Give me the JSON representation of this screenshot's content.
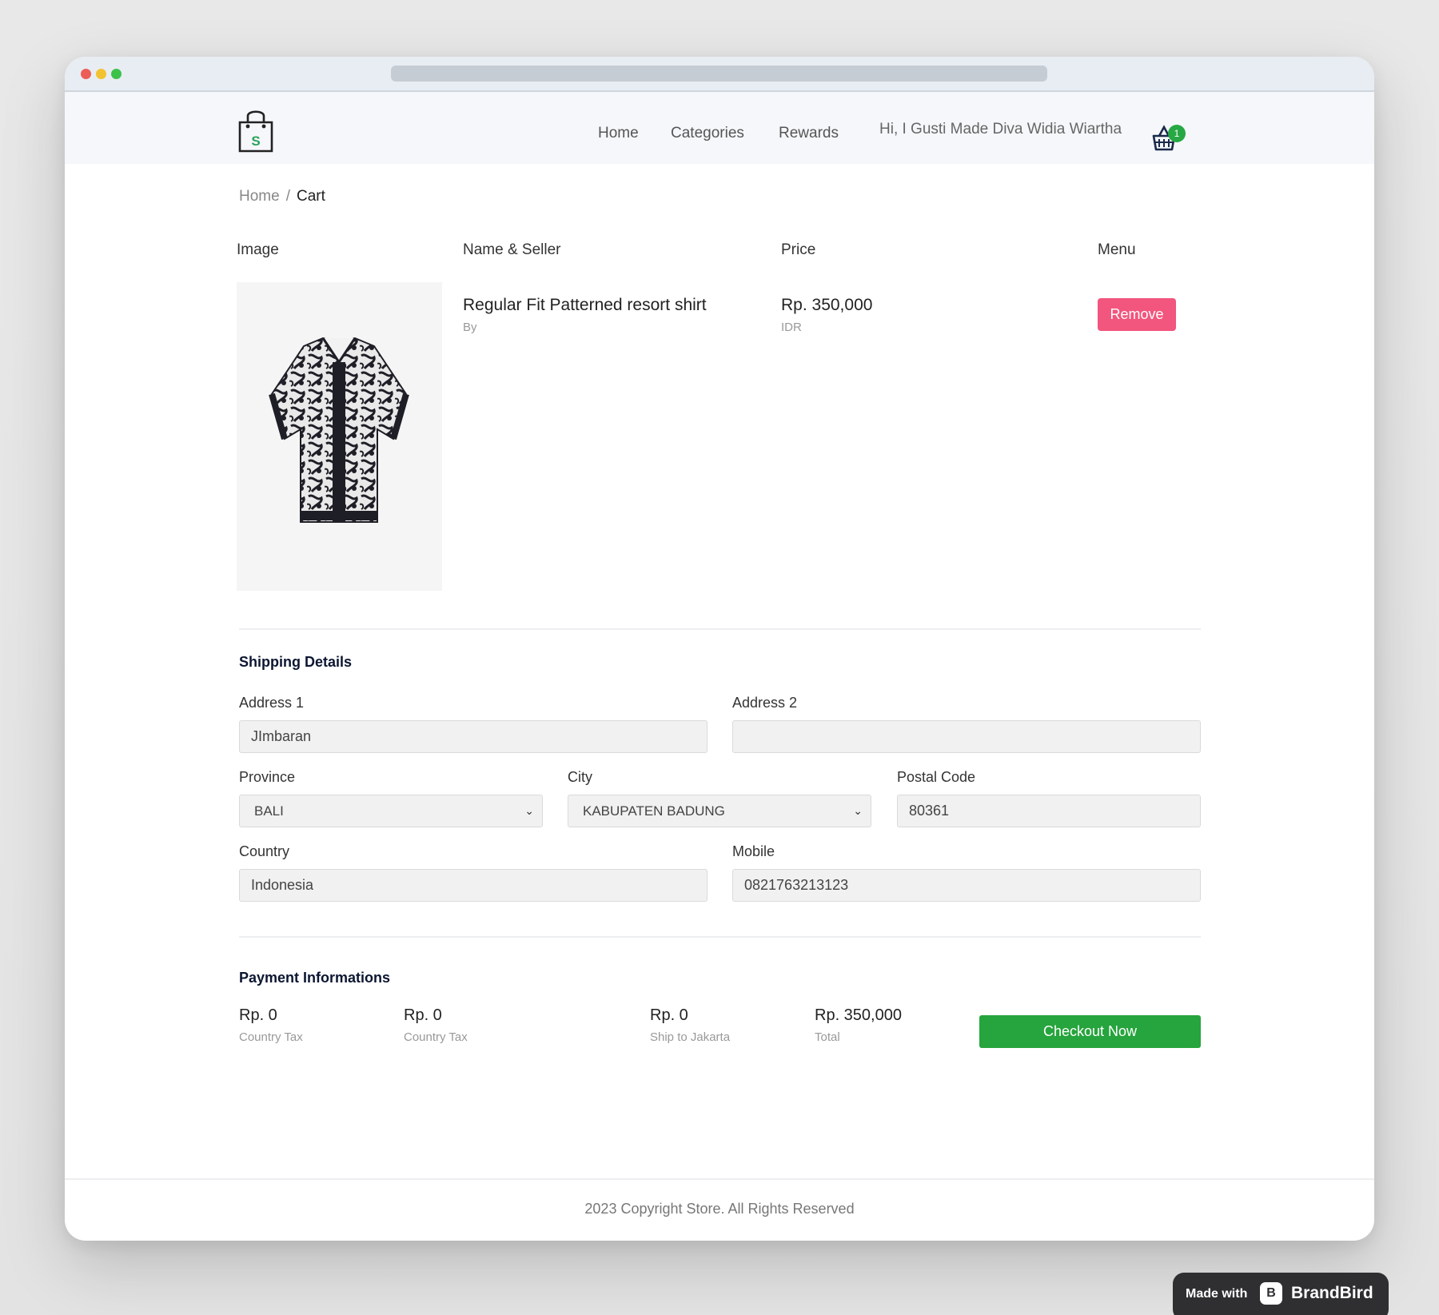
{
  "navbar": {
    "logo_letter": "S",
    "links": [
      "Home",
      "Categories",
      "Rewards"
    ],
    "greeting": "Hi, I Gusti Made Diva Widia Wiartha",
    "cart_count": "1"
  },
  "breadcrumb": {
    "home": "Home",
    "separator": "/",
    "current": "Cart"
  },
  "cart": {
    "headers": [
      "Image",
      "Name & Seller",
      "Price",
      "Menu"
    ],
    "item": {
      "name": "Regular Fit Patterned resort shirt",
      "seller": "By",
      "price": "Rp. 350,000",
      "currency": "IDR",
      "remove_label": "Remove"
    }
  },
  "shipping": {
    "title": "Shipping Details",
    "address1": {
      "label": "Address 1",
      "value": "JImbaran"
    },
    "address2": {
      "label": "Address 2",
      "value": ""
    },
    "province": {
      "label": "Province",
      "value": "BALI"
    },
    "city": {
      "label": "City",
      "value": "KABUPATEN BADUNG"
    },
    "postal_code": {
      "label": "Postal Code",
      "value": "80361"
    },
    "country": {
      "label": "Country",
      "value": "Indonesia"
    },
    "mobile": {
      "label": "Mobile",
      "value": "0821763213123"
    }
  },
  "payment": {
    "title": "Payment Informations",
    "items": [
      {
        "amount": "Rp. 0",
        "label": "Country Tax"
      },
      {
        "amount": "Rp. 0",
        "label": "Country Tax"
      },
      {
        "amount": "Rp. 0",
        "label": "Ship to Jakarta"
      },
      {
        "amount": "Rp. 350,000",
        "label": "Total"
      }
    ],
    "checkout_label": "Checkout Now"
  },
  "footer": {
    "text": "2023 Copyright Store. All Rights Reserved"
  },
  "badge": {
    "made_with": "Made with",
    "brand_logo": "B",
    "brand": "BrandBird"
  },
  "colors": {
    "remove": "#f2557d",
    "checkout": "#26a43d",
    "cart_badge": "#27a844",
    "logo_s": "#2aa35a"
  }
}
